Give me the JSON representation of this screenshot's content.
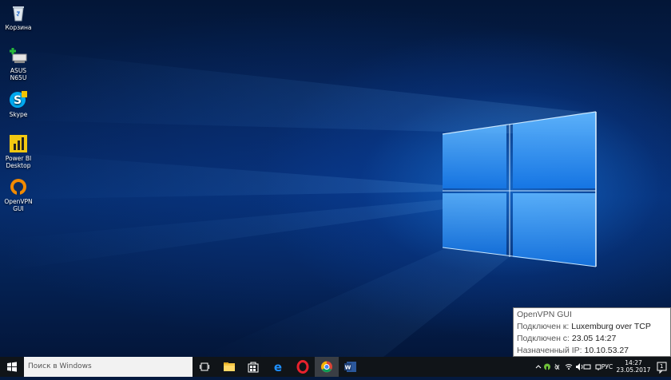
{
  "desktop": {
    "icons": [
      {
        "label": "Корзина",
        "icon": "recycle-bin-icon"
      },
      {
        "label": "ASUS N65U",
        "icon": "network-drive-icon"
      },
      {
        "label": "Skype",
        "icon": "skype-icon"
      },
      {
        "label": "Power BI Desktop",
        "icon": "power-bi-icon"
      },
      {
        "label": "OpenVPN GUI",
        "icon": "openvpn-icon"
      }
    ]
  },
  "taskbar": {
    "search_placeholder": "Поиск в Windows",
    "pinned": [
      "task-view-icon",
      "file-explorer-icon",
      "store-icon",
      "edge-icon",
      "opera-icon",
      "chrome-icon",
      "word-icon"
    ],
    "language": "РУС",
    "time": "14:27",
    "date": "23.05.2017",
    "notification_count": "1"
  },
  "tooltip": {
    "title": "OpenVPN GUI",
    "connected_to_label": "Подключен к:",
    "connected_to_value": "Luxemburg over TCP",
    "connected_since_label": "Подключен с:",
    "connected_since_value": "23.05 14:27",
    "assigned_ip_label": "Назначенный IP:",
    "assigned_ip_value": "10.10.53.27"
  },
  "colors": {
    "taskbar": "#101418",
    "accent": "#1e90ff",
    "search_bg": "#f2f2f2"
  }
}
